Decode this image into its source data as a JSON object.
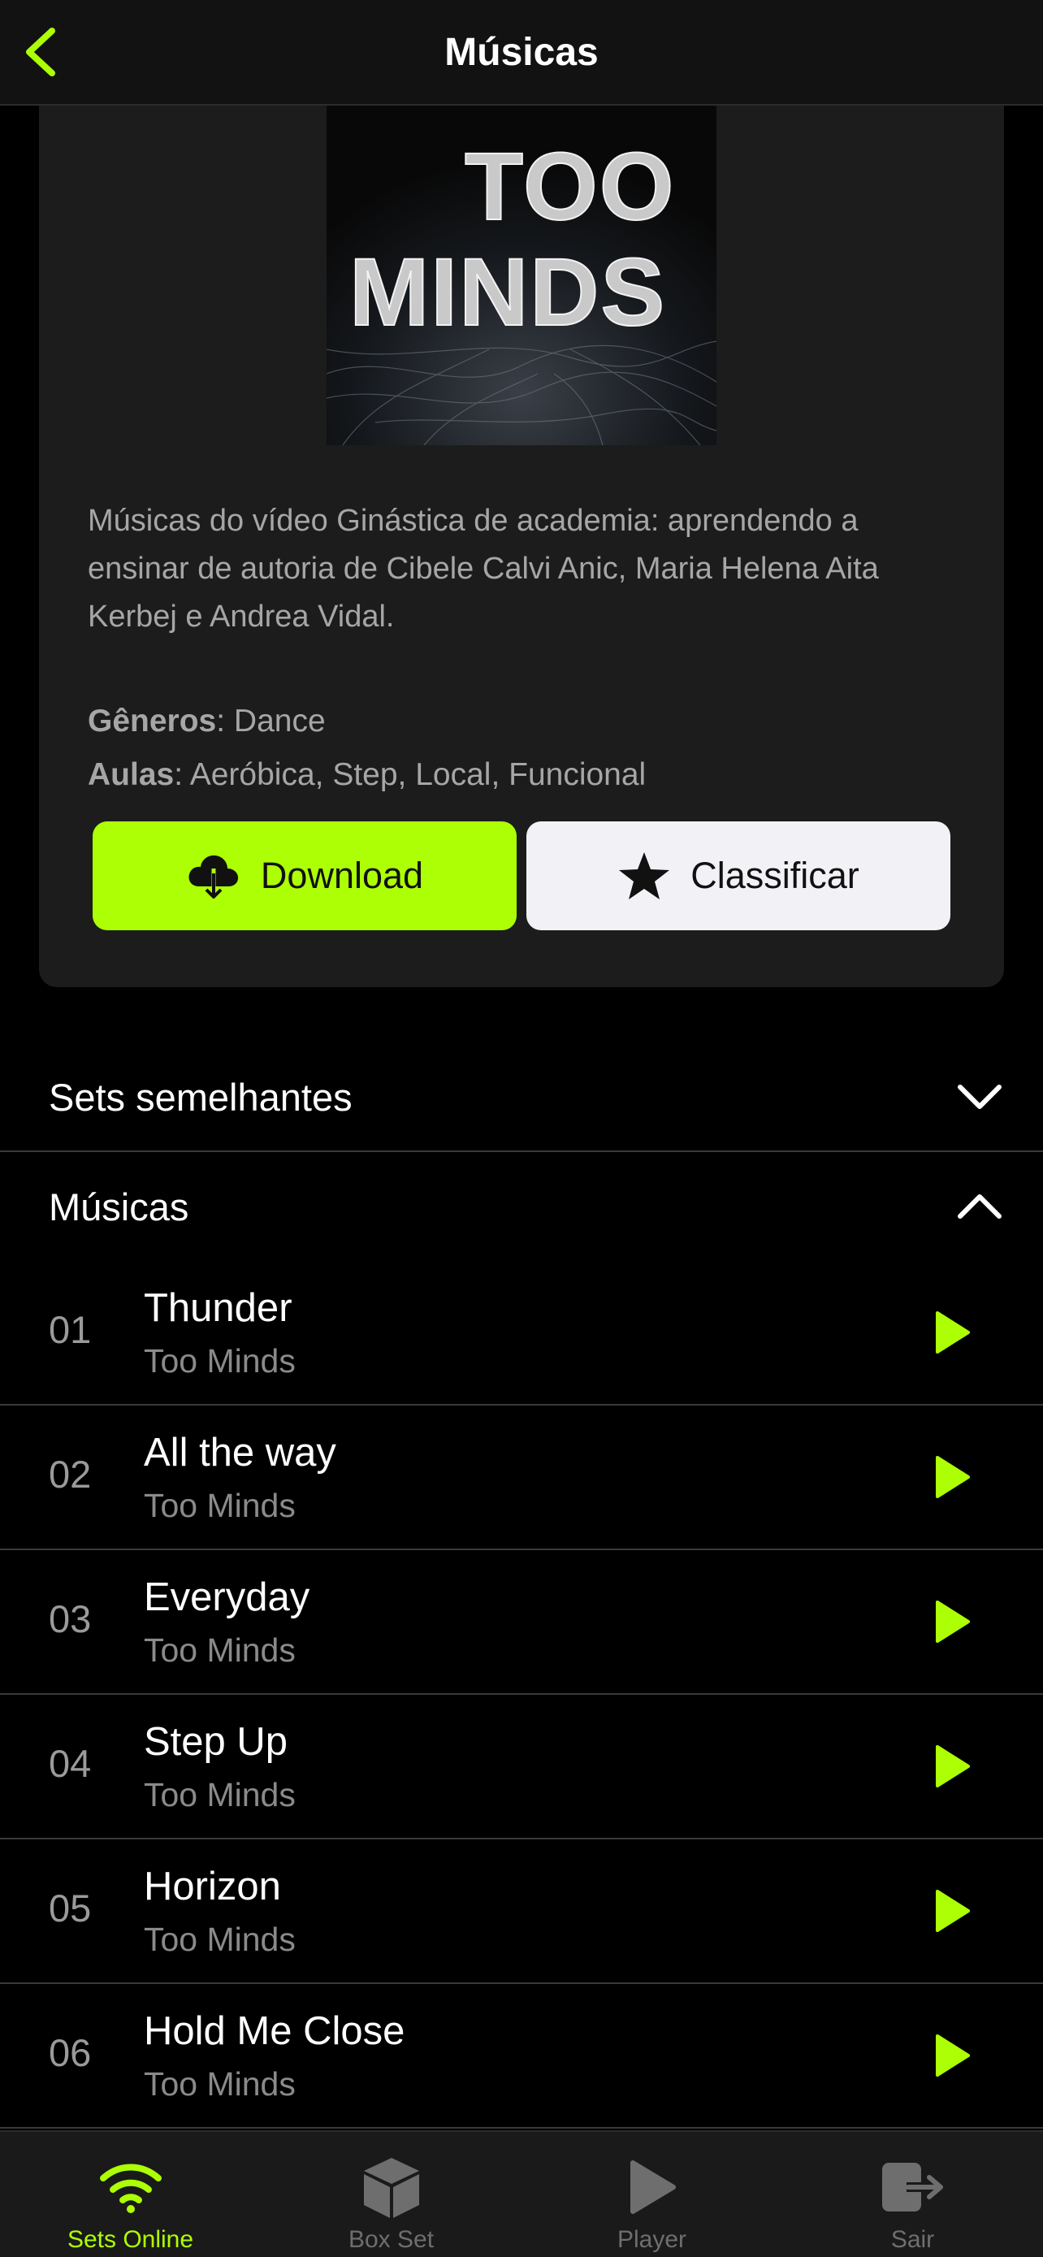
{
  "header": {
    "title": "Músicas",
    "back_icon": "chevron-left-icon"
  },
  "colors": {
    "accent": "#adff05",
    "background": "#000000",
    "card": "#1c1c1c",
    "rate_button": "#f2f2f6"
  },
  "album": {
    "cover_text_line1": "TOO",
    "cover_text_line2": "MINDS",
    "description": "Músicas do vídeo Ginástica de academia: aprendendo a ensinar de autoria de Cibele Calvi Anic, Maria Helena Aita Kerbej e Andrea Vidal.",
    "genres_label": "Gêneros",
    "genres_value": ": Dance",
    "classes_label": "Aulas",
    "classes_value": ": Aeróbica, Step, Local, Funcional"
  },
  "actions": {
    "download_label": "Download",
    "download_icon": "cloud-download-icon",
    "rate_label": "Classificar",
    "rate_icon": "star-icon"
  },
  "sections": {
    "similar_label": "Sets semelhantes",
    "similar_icon": "chevron-down-icon",
    "tracks_label": "Músicas",
    "tracks_icon": "chevron-up-icon"
  },
  "tracks": [
    {
      "number": "01",
      "title": "Thunder",
      "artist": "Too Minds"
    },
    {
      "number": "02",
      "title": "All the way",
      "artist": "Too Minds"
    },
    {
      "number": "03",
      "title": "Everyday",
      "artist": "Too Minds"
    },
    {
      "number": "04",
      "title": "Step Up",
      "artist": "Too Minds"
    },
    {
      "number": "05",
      "title": "Horizon",
      "artist": "Too Minds"
    },
    {
      "number": "06",
      "title": "Hold Me Close",
      "artist": "Too Minds"
    }
  ],
  "tabbar": [
    {
      "label": "Sets Online",
      "icon": "wifi-icon",
      "active": true
    },
    {
      "label": "Box Set",
      "icon": "box-icon",
      "active": false
    },
    {
      "label": "Player",
      "icon": "play-icon",
      "active": false
    },
    {
      "label": "Sair",
      "icon": "logout-icon",
      "active": false
    }
  ]
}
